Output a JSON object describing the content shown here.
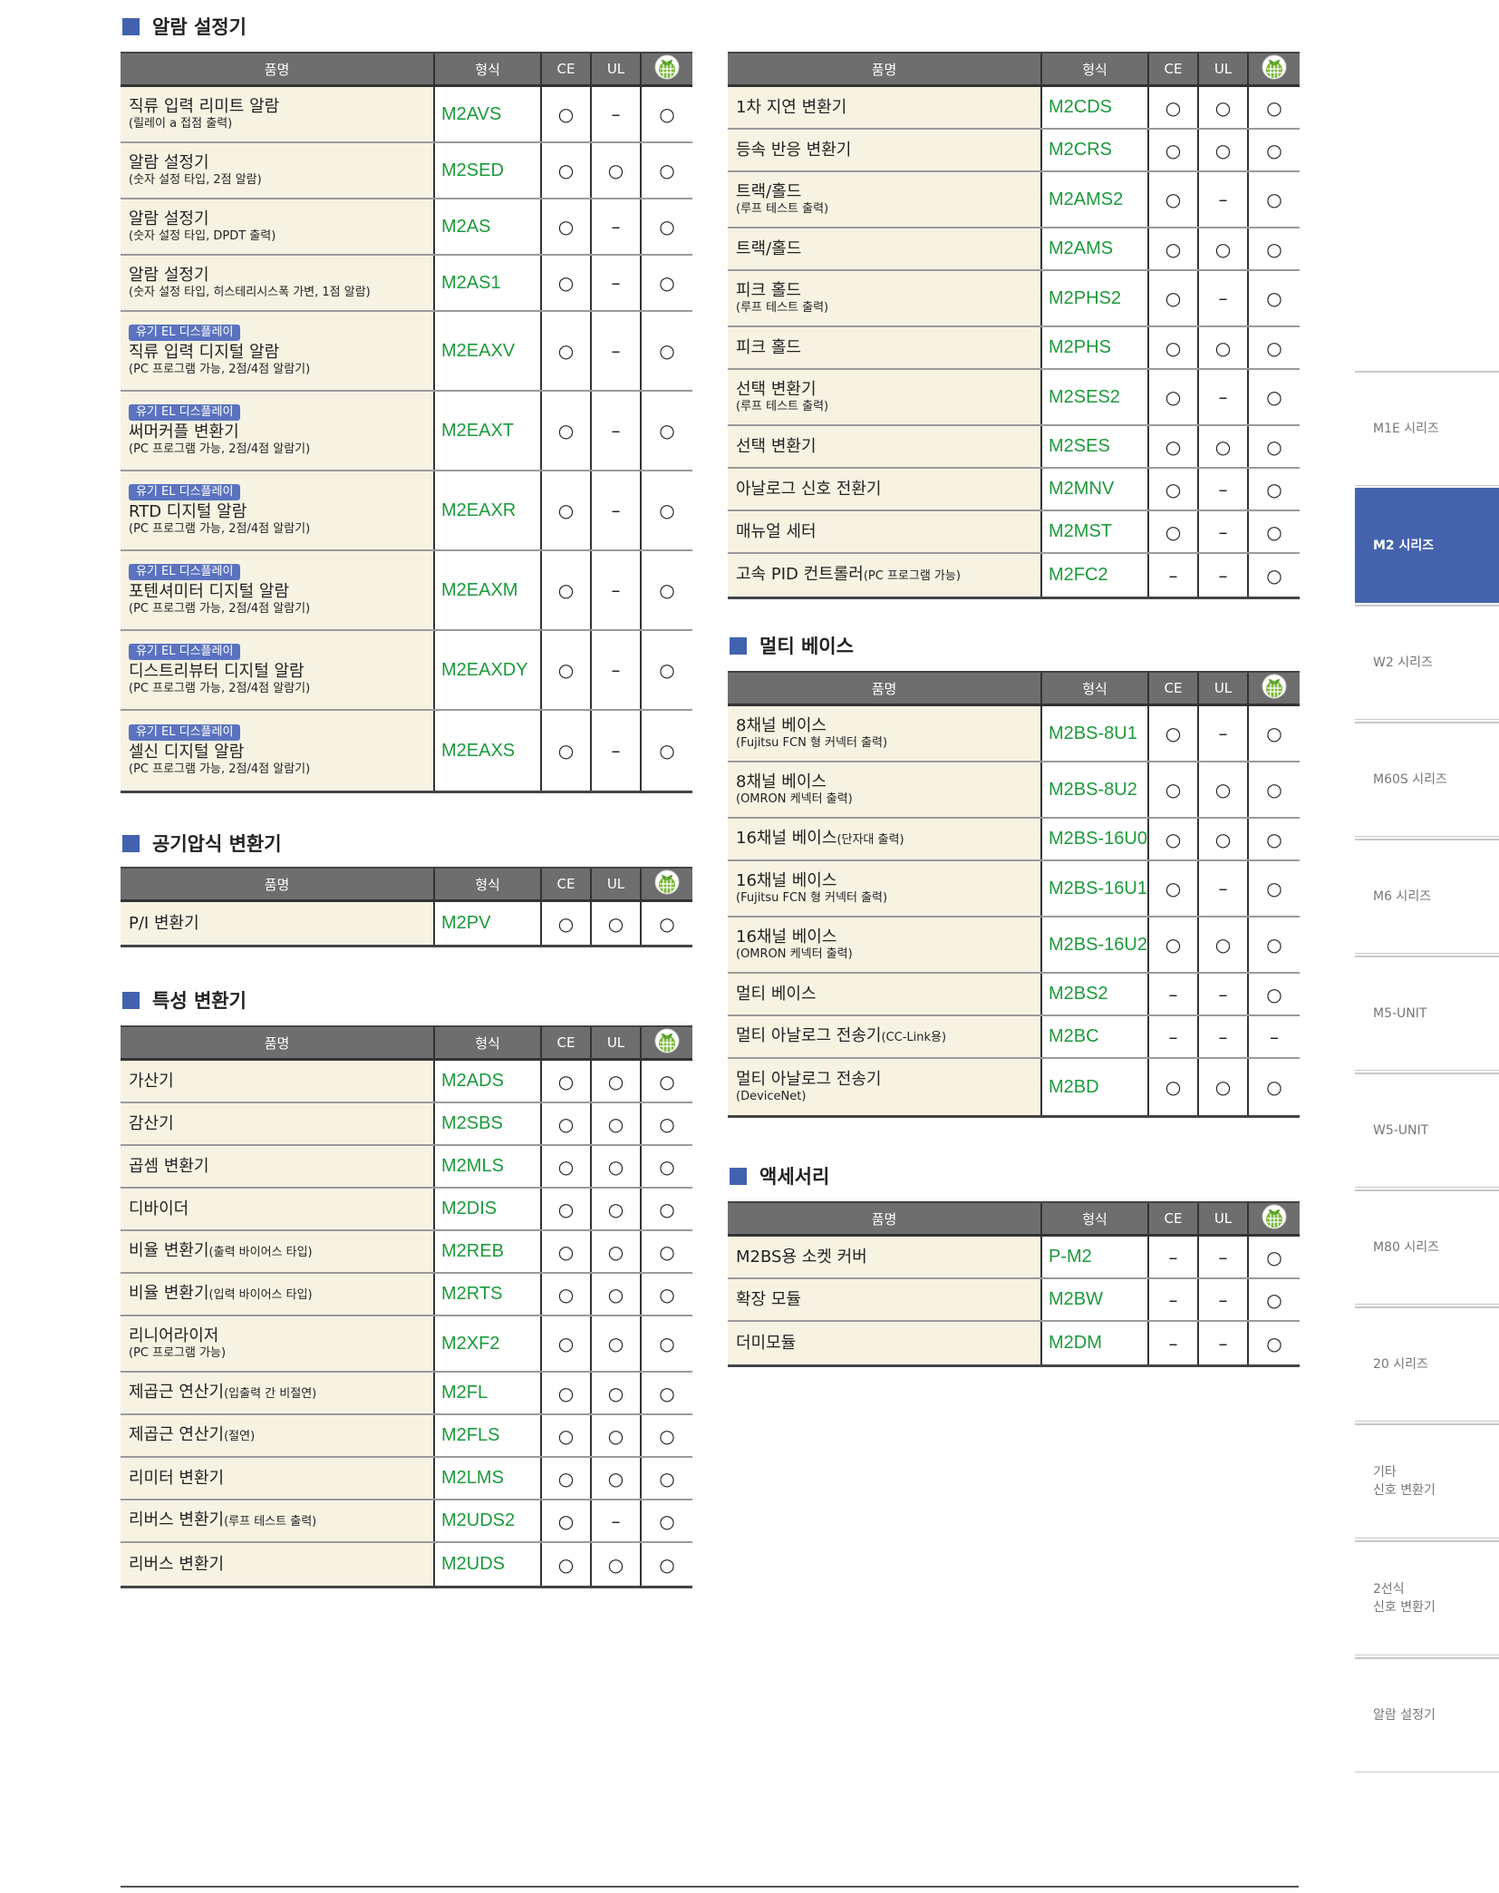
{
  "colors": {
    "accent": "#4262b0",
    "model": "#1b9a3a",
    "name_bg": "#f7f3e3",
    "header_bg": "#6e6e6e",
    "badge": "#5a72c0"
  },
  "table_header": {
    "name": "품명",
    "model": "형식",
    "ce": "CE",
    "ul": "UL",
    "eco_icon": "eco-leaf-icon"
  },
  "sections": {
    "alarm": "알람 설정기",
    "pneumatic": "공기압식 변환기",
    "characteristic": "특성 변환기",
    "multibase": "멀티 베이스",
    "accessory": "액세서리"
  },
  "tables": {
    "alarm": [
      {
        "name": "직류 입력 리미트 알람",
        "sub": "(릴레이 a 접점 출력)",
        "model": "M2AVS",
        "ce": "○",
        "ul": "–",
        "eco": "○"
      },
      {
        "name": "알람 설정기",
        "sub": "(숫자 설정 타입, 2점 알람)",
        "model": "M2SED",
        "ce": "○",
        "ul": "○",
        "eco": "○"
      },
      {
        "name": "알람 설정기",
        "sub": "(숫자 설정 타입, DPDT 출력)",
        "model": "M2AS",
        "ce": "○",
        "ul": "–",
        "eco": "○"
      },
      {
        "name": "알람 설정기",
        "sub": "(숫자 설정 타입, 히스테리시스폭 가변, 1점 알람)",
        "model": "M2AS1",
        "ce": "○",
        "ul": "–",
        "eco": "○"
      },
      {
        "badge": "유기 EL 디스플레이",
        "name": "직류 입력 디지털 알람",
        "sub": "(PC 프로그램 가능, 2점/4점 알람기)",
        "model": "M2EAXV",
        "ce": "○",
        "ul": "–",
        "eco": "○"
      },
      {
        "badge": "유기 EL 디스플레이",
        "name": "써머커플 변환기",
        "sub": "(PC 프로그램 가능, 2점/4점 알람기)",
        "model": "M2EAXT",
        "ce": "○",
        "ul": "–",
        "eco": "○"
      },
      {
        "badge": "유기 EL 디스플레이",
        "name": "RTD 디지털 알람",
        "sub": "(PC 프로그램 가능, 2점/4점 알람기)",
        "model": "M2EAXR",
        "ce": "○",
        "ul": "–",
        "eco": "○"
      },
      {
        "badge": "유기 EL 디스플레이",
        "name": "포텐셔미터 디지털 알람",
        "sub": "(PC 프로그램 가능, 2점/4점 알람기)",
        "model": "M2EAXM",
        "ce": "○",
        "ul": "–",
        "eco": "○"
      },
      {
        "badge": "유기 EL 디스플레이",
        "name": "디스트리뷰터 디지털 알람",
        "sub": "(PC 프로그램 가능, 2점/4점 알람기)",
        "model": "M2EAXDY",
        "ce": "○",
        "ul": "–",
        "eco": "○"
      },
      {
        "badge": "유기 EL 디스플레이",
        "name": "셀신 디지털 알람",
        "sub": "(PC 프로그램 가능, 2점/4점 알람기)",
        "model": "M2EAXS",
        "ce": "○",
        "ul": "–",
        "eco": "○"
      }
    ],
    "pneumatic": [
      {
        "name": "P/I 변환기",
        "model": "M2PV",
        "ce": "○",
        "ul": "○",
        "eco": "○"
      }
    ],
    "characteristic": [
      {
        "name": "가산기",
        "model": "M2ADS",
        "ce": "○",
        "ul": "○",
        "eco": "○"
      },
      {
        "name": "감산기",
        "model": "M2SBS",
        "ce": "○",
        "ul": "○",
        "eco": "○"
      },
      {
        "name": "곱셈 변환기",
        "model": "M2MLS",
        "ce": "○",
        "ul": "○",
        "eco": "○"
      },
      {
        "name": "디바이더",
        "model": "M2DIS",
        "ce": "○",
        "ul": "○",
        "eco": "○"
      },
      {
        "name": "비율 변환기",
        "note": "(출력 바이어스 타입)",
        "model": "M2REB",
        "ce": "○",
        "ul": "○",
        "eco": "○"
      },
      {
        "name": "비율 변환기",
        "note": "(입력 바이어스 타입)",
        "model": "M2RTS",
        "ce": "○",
        "ul": "○",
        "eco": "○"
      },
      {
        "name": "리니어라이저",
        "sub": "(PC 프로그램 가능)",
        "model": "M2XF2",
        "ce": "○",
        "ul": "○",
        "eco": "○"
      },
      {
        "name": "제곱근 연산기",
        "note": "(입출력 간 비절연)",
        "model": "M2FL",
        "ce": "○",
        "ul": "○",
        "eco": "○"
      },
      {
        "name": "제곱근 연산기",
        "note": "(절연)",
        "model": "M2FLS",
        "ce": "○",
        "ul": "○",
        "eco": "○"
      },
      {
        "name": "리미터 변환기",
        "model": "M2LMS",
        "ce": "○",
        "ul": "○",
        "eco": "○"
      },
      {
        "name": "리버스 변환기",
        "note": "(루프 테스트 출력)",
        "model": "M2UDS2",
        "ce": "○",
        "ul": "–",
        "eco": "○"
      },
      {
        "name": "리버스 변환기",
        "model": "M2UDS",
        "ce": "○",
        "ul": "○",
        "eco": "○"
      }
    ],
    "misc": [
      {
        "name": "1차 지연 변환기",
        "model": "M2CDS",
        "ce": "○",
        "ul": "○",
        "eco": "○"
      },
      {
        "name": "등속 반응 변환기",
        "model": "M2CRS",
        "ce": "○",
        "ul": "○",
        "eco": "○"
      },
      {
        "name": "트랙/홀드",
        "sub": "(루프 테스트 출력)",
        "model": "M2AMS2",
        "ce": "○",
        "ul": "–",
        "eco": "○"
      },
      {
        "name": "트랙/홀드",
        "model": "M2AMS",
        "ce": "○",
        "ul": "○",
        "eco": "○"
      },
      {
        "name": "피크 홀드",
        "sub": "(루프 테스트 출력)",
        "model": "M2PHS2",
        "ce": "○",
        "ul": "–",
        "eco": "○"
      },
      {
        "name": "피크 홀드",
        "model": "M2PHS",
        "ce": "○",
        "ul": "○",
        "eco": "○"
      },
      {
        "name": "선택 변환기",
        "sub": "(루프 테스트 출력)",
        "model": "M2SES2",
        "ce": "○",
        "ul": "–",
        "eco": "○"
      },
      {
        "name": "선택 변환기",
        "model": "M2SES",
        "ce": "○",
        "ul": "○",
        "eco": "○"
      },
      {
        "name": "아날로그 신호 전환기",
        "model": "M2MNV",
        "ce": "○",
        "ul": "–",
        "eco": "○"
      },
      {
        "name": "매뉴얼 세터",
        "model": "M2MST",
        "ce": "○",
        "ul": "–",
        "eco": "○"
      },
      {
        "name": "고속 PID 컨트롤러",
        "note": "(PC 프로그램 가능)",
        "model": "M2FC2",
        "ce": "–",
        "ul": "–",
        "eco": "○"
      }
    ],
    "multibase": [
      {
        "name": "8채널 베이스",
        "sub": "(Fujitsu FCN 형 커넥터 출력)",
        "model": "M2BS-8U1",
        "ce": "○",
        "ul": "–",
        "eco": "○"
      },
      {
        "name": "8채널 베이스",
        "sub": "(OMRON 케넥터 출력)",
        "model": "M2BS-8U2",
        "ce": "○",
        "ul": "○",
        "eco": "○"
      },
      {
        "name": "16채널 베이스",
        "note": "(단자대 출력)",
        "model": "M2BS-16U0",
        "ce": "○",
        "ul": "○",
        "eco": "○"
      },
      {
        "name": "16채널 베이스",
        "sub": "(Fujitsu FCN 형 커넥터 출력)",
        "model": "M2BS-16U1",
        "ce": "○",
        "ul": "–",
        "eco": "○"
      },
      {
        "name": "16채널 베이스",
        "sub": "(OMRON 케넥터 출력)",
        "model": "M2BS-16U2",
        "ce": "○",
        "ul": "○",
        "eco": "○"
      },
      {
        "name": "멀티 베이스",
        "model": "M2BS2",
        "ce": "–",
        "ul": "–",
        "eco": "○"
      },
      {
        "name": "멀티 아날로그 전송기",
        "note": "(CC-Link용)",
        "model": "M2BC",
        "ce": "–",
        "ul": "–",
        "eco": "–"
      },
      {
        "name": "멀티 아날로그 전송기",
        "sub": "(DeviceNet)",
        "model": "M2BD",
        "ce": "○",
        "ul": "○",
        "eco": "○"
      }
    ],
    "accessory": [
      {
        "name": "M2BS용 소켓 커버",
        "model": "P-M2",
        "ce": "–",
        "ul": "–",
        "eco": "○"
      },
      {
        "name": "확장 모듈",
        "model": "M2BW",
        "ce": "–",
        "ul": "–",
        "eco": "○"
      },
      {
        "name": "더미모듈",
        "model": "M2DM",
        "ce": "–",
        "ul": "–",
        "eco": "○"
      }
    ]
  },
  "sidebar": {
    "items": [
      {
        "label": "M1E 시리즈"
      },
      {
        "label": "M2 시리즈",
        "active": true
      },
      {
        "label": "W2 시리즈"
      },
      {
        "label": "M60S 시리즈"
      },
      {
        "label": "M6 시리즈"
      },
      {
        "label": "M5-UNIT"
      },
      {
        "label": "W5-UNIT"
      },
      {
        "label": "M80 시리즈"
      },
      {
        "label": "20 시리즈"
      },
      {
        "label": "기타\n신호 변환기"
      },
      {
        "label": "2선식\n신호 변환기"
      },
      {
        "label": "알람 설정기"
      }
    ]
  }
}
